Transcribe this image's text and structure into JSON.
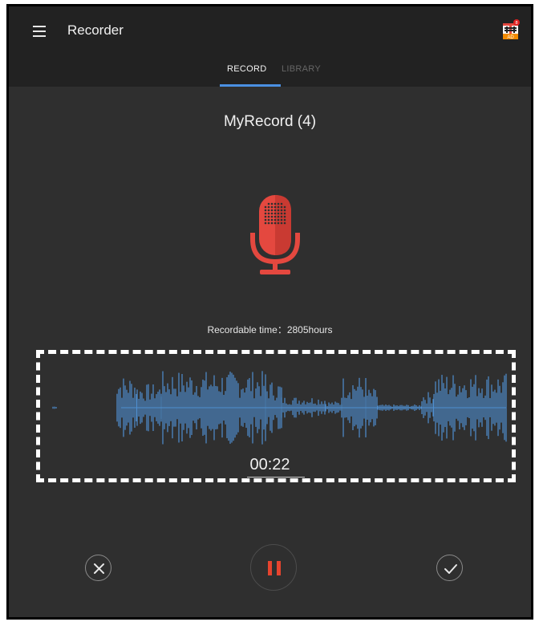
{
  "app_bar": {
    "title": "Recorder",
    "menu_icon": "hamburger-menu-icon",
    "ad_icon": "ad-gift-icon",
    "ad_label": "AD",
    "ad_badge": "8"
  },
  "tabs": [
    {
      "label": "RECORD",
      "active": true
    },
    {
      "label": "LIBRARY",
      "active": false
    }
  ],
  "recording": {
    "name": "MyRecord (4)",
    "recordable_time": "Recordable time：2805hours",
    "elapsed": "00:22"
  },
  "controls": {
    "cancel_icon": "close-icon",
    "pause_icon": "pause-icon",
    "confirm_icon": "checkmark-icon"
  },
  "colors": {
    "background": "#2f2f2f",
    "app_bar": "#222222",
    "accent": "#4a90e2",
    "mic_red": "#e4483f",
    "waveform": "#4f8fd0",
    "pause_red": "#e6442e"
  }
}
